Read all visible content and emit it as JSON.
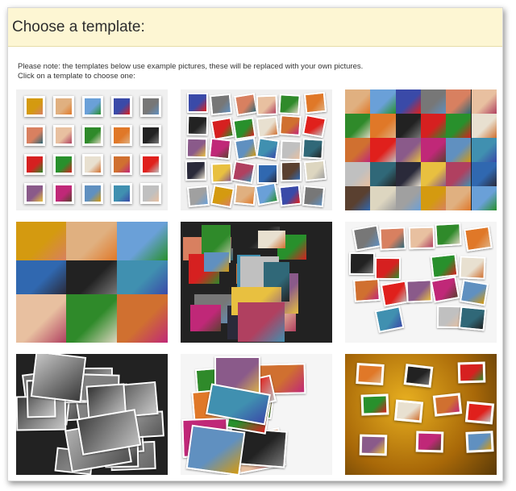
{
  "header": {
    "title": "Choose a template:"
  },
  "notes": {
    "line1": "Please note: the templates below use example pictures, these will be replaced with your own pictures.",
    "line2": "Click on a template to choose one:"
  },
  "photo_colors": [
    "#d49a10",
    "#e0b080",
    "#6aa0d8",
    "#3a4aa8",
    "#777777",
    "#d88060",
    "#e8c0a0",
    "#2f8a2a",
    "#e07828",
    "#222222",
    "#d62020",
    "#28902c",
    "#e8e0d0",
    "#d07030",
    "#e0201c",
    "#8a5a8a",
    "#c02878",
    "#6090c0",
    "#4090b0",
    "#c0c0c0",
    "#306878",
    "#2a2a3a",
    "#e8c040",
    "#b04060",
    "#3068b0",
    "#5a4030",
    "#ddd6c0",
    "#a0a0a0"
  ]
}
